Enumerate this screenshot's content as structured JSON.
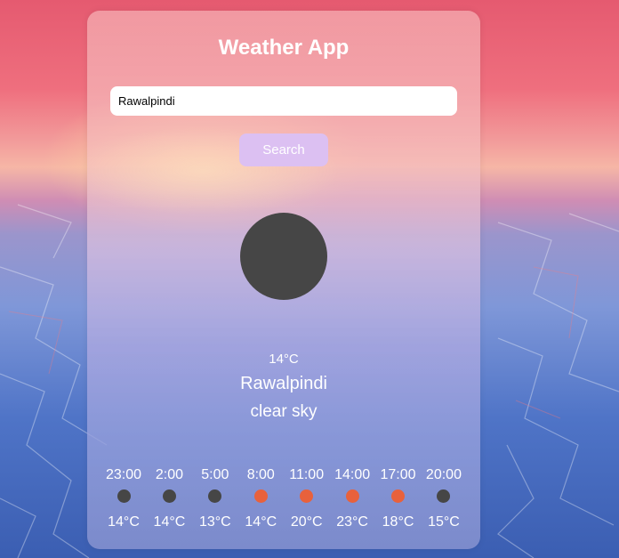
{
  "app": {
    "title": "Weather App"
  },
  "search": {
    "value": "Rawalpindi",
    "button_label": "Search"
  },
  "current": {
    "icon": "moon-icon",
    "icon_color": "#464646",
    "temperature": "14°C",
    "city": "Rawalpindi",
    "description": "clear sky"
  },
  "forecast": [
    {
      "time": "23:00",
      "temp": "14°C",
      "icon": "night-icon",
      "icon_color": "#464646"
    },
    {
      "time": "2:00",
      "temp": "14°C",
      "icon": "night-icon",
      "icon_color": "#464646"
    },
    {
      "time": "5:00",
      "temp": "13°C",
      "icon": "night-icon",
      "icon_color": "#464646"
    },
    {
      "time": "8:00",
      "temp": "14°C",
      "icon": "sun-icon",
      "icon_color": "#e8613c"
    },
    {
      "time": "11:00",
      "temp": "20°C",
      "icon": "sun-icon",
      "icon_color": "#e8613c"
    },
    {
      "time": "14:00",
      "temp": "23°C",
      "icon": "sun-icon",
      "icon_color": "#e8613c"
    },
    {
      "time": "17:00",
      "temp": "18°C",
      "icon": "sun-icon",
      "icon_color": "#e8613c"
    },
    {
      "time": "20:00",
      "temp": "15°C",
      "icon": "night-icon",
      "icon_color": "#464646"
    }
  ],
  "colors": {
    "button_bg": "#dcc0f2",
    "text": "#ffffff"
  }
}
